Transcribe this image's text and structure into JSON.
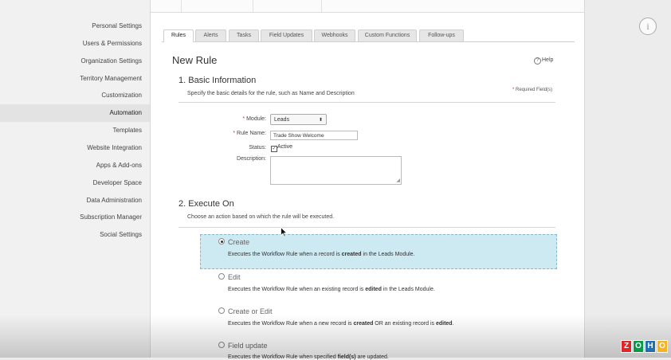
{
  "sidebar": {
    "items": [
      {
        "label": "Personal Settings"
      },
      {
        "label": "Users & Permissions"
      },
      {
        "label": "Organization Settings"
      },
      {
        "label": "Territory Management"
      },
      {
        "label": "Customization"
      },
      {
        "label": "Automation"
      },
      {
        "label": "Templates"
      },
      {
        "label": "Website Integration"
      },
      {
        "label": "Apps & Add-ons"
      },
      {
        "label": "Developer Space"
      },
      {
        "label": "Data Administration"
      },
      {
        "label": "Subscription Manager"
      },
      {
        "label": "Social Settings"
      }
    ],
    "active": "Automation"
  },
  "tabs": [
    {
      "label": "Rules"
    },
    {
      "label": "Alerts"
    },
    {
      "label": "Tasks"
    },
    {
      "label": "Field Updates"
    },
    {
      "label": "Webhooks"
    },
    {
      "label": "Custom Functions"
    },
    {
      "label": "Follow-ups"
    }
  ],
  "page": {
    "title": "New Rule",
    "help": "Help"
  },
  "basic": {
    "title": "1. Basic Information",
    "desc": "Specify the basic details for the rule, such as Name and Description",
    "required_star": "*",
    "required_note": "Required Field(s)",
    "module_label": "Module:",
    "module_value": "Leads",
    "rule_name_label": "Rule Name:",
    "rule_name_value": "Trade Show Welcome",
    "status_label": "Status:",
    "status_option": "Active",
    "description_label": "Description:"
  },
  "execute": {
    "title": "2. Execute On",
    "desc": "Choose an action based on which the rule will be executed.",
    "options": [
      {
        "title": "Create",
        "pre": "Executes the Workflow Rule when a record is ",
        "bold": "created",
        "post": " in the Leads Module.",
        "selected": true
      },
      {
        "title": "Edit",
        "pre": "Executes the Workflow Rule when an existing record is ",
        "bold": "edited",
        "post": " in the Leads Module.",
        "selected": false
      },
      {
        "title": "Create or Edit",
        "pre": "Executes the Workflow Rule when a new record is ",
        "bold": "created",
        "mid": " OR an existing record is ",
        "bold2": "edited",
        "post": ".",
        "selected": false
      },
      {
        "title": "Field update",
        "pre": "Executes the Workflow Rule when specified ",
        "bold": "field(s)",
        "post": " are updated.",
        "selected": false
      }
    ]
  },
  "icons": {
    "info": "info-icon",
    "cursor": "mouse-pointer-icon"
  },
  "logo": {
    "letters": [
      "Z",
      "O",
      "H",
      "O"
    ],
    "colors": [
      "#e42527",
      "#089949",
      "#226db4",
      "#f9b21d"
    ]
  }
}
